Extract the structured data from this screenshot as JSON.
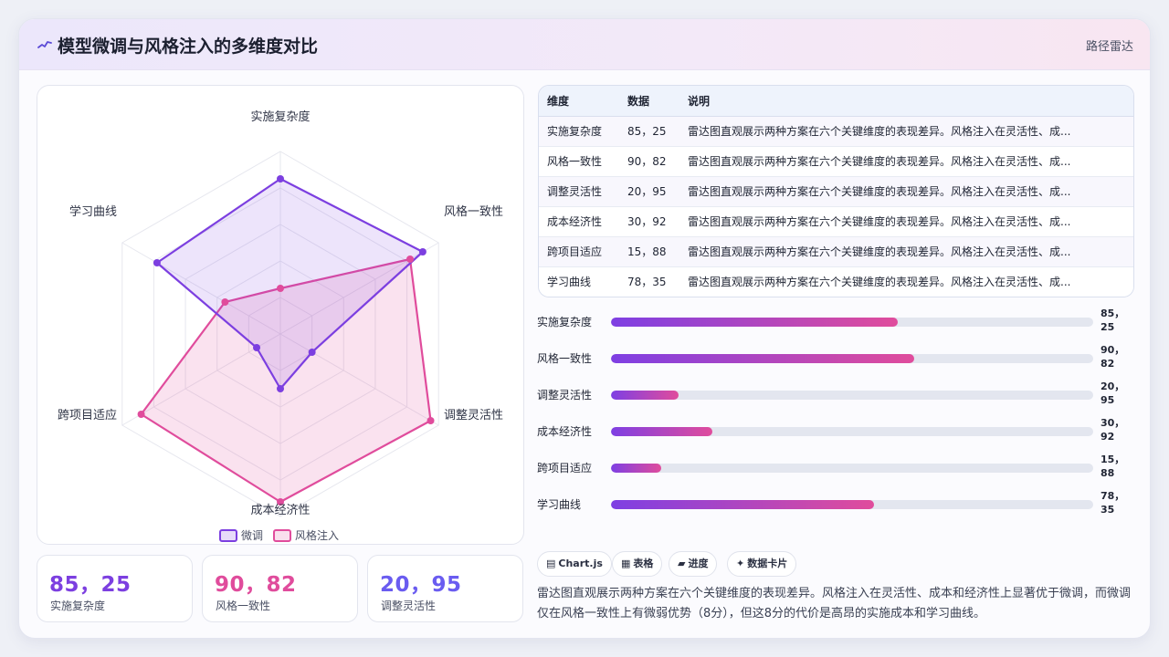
{
  "header": {
    "title": "模型微调与风格注入的多维度对比",
    "icon": "sparkline-icon",
    "right_label": "路径雷达"
  },
  "colors": {
    "series_a": "#7c3fe0",
    "series_b": "#e04c9c",
    "accent_blue": "#6a5cf0"
  },
  "chart_data": {
    "type": "radar",
    "categories": [
      "实施复杂度",
      "风格一致性",
      "调整灵活性",
      "成本经济性",
      "跨项目适应",
      "学习曲线"
    ],
    "series": [
      {
        "name": "微调",
        "values": [
          85,
          90,
          20,
          30,
          15,
          78
        ],
        "color": "#7c3fe0"
      },
      {
        "name": "风格注入",
        "values": [
          25,
          82,
          95,
          92,
          88,
          35
        ],
        "color": "#e04c9c"
      }
    ],
    "range": [
      0,
      100
    ],
    "grid": "hexagon",
    "legend": "bottom"
  },
  "stats": [
    {
      "value": "85，25",
      "label": "实施复杂度",
      "color": "#7c3fe0"
    },
    {
      "value": "90，82",
      "label": "风格一致性",
      "color": "#e04c9c"
    },
    {
      "value": "20，95",
      "label": "调整灵活性",
      "color": "#6a5cf0"
    }
  ],
  "table": {
    "headers": [
      "维度",
      "数据",
      "说明"
    ],
    "rows": [
      [
        "实施复杂度",
        "85，25",
        "雷达图直观展示两种方案在六个关键维度的表现差异。风格注入在灵活性、成..."
      ],
      [
        "风格一致性",
        "90，82",
        "雷达图直观展示两种方案在六个关键维度的表现差异。风格注入在灵活性、成..."
      ],
      [
        "调整灵活性",
        "20，95",
        "雷达图直观展示两种方案在六个关键维度的表现差异。风格注入在灵活性、成..."
      ],
      [
        "成本经济性",
        "30，92",
        "雷达图直观展示两种方案在六个关键维度的表现差异。风格注入在灵活性、成..."
      ],
      [
        "跨项目适应",
        "15，88",
        "雷达图直观展示两种方案在六个关键维度的表现差异。风格注入在灵活性、成..."
      ],
      [
        "学习曲线",
        "78，35",
        "雷达图直观展示两种方案在六个关键维度的表现差异。风格注入在灵活性、成..."
      ]
    ]
  },
  "bars": [
    {
      "label": "实施复杂度",
      "value": "85，25",
      "fill": 0.594
    },
    {
      "label": "风格一致性",
      "value": "90，82",
      "fill": 0.629
    },
    {
      "label": "调整灵活性",
      "value": "20，95",
      "fill": 0.14
    },
    {
      "label": "成本经济性",
      "value": "30，92",
      "fill": 0.21
    },
    {
      "label": "跨项目适应",
      "value": "15，88",
      "fill": 0.105
    },
    {
      "label": "学习曲线",
      "value": "78，35",
      "fill": 0.545
    }
  ],
  "tags": [
    {
      "icon": "chart-icon",
      "glyph": "▤",
      "label": "Chart.js"
    },
    {
      "icon": "table-icon",
      "glyph": "▦",
      "label": "表格"
    },
    {
      "icon": "progress-icon",
      "glyph": "▰",
      "label": "进度"
    },
    {
      "icon": "card-icon",
      "glyph": "✦",
      "label": "数据卡片"
    }
  ],
  "summary": "雷达图直观展示两种方案在六个关键维度的表现差异。风格注入在灵活性、成本和经济性上显著优于微调，而微调仅在风格一致性上有微弱优势（8分），但这8分的代价是高昂的实施成本和学习曲线。"
}
